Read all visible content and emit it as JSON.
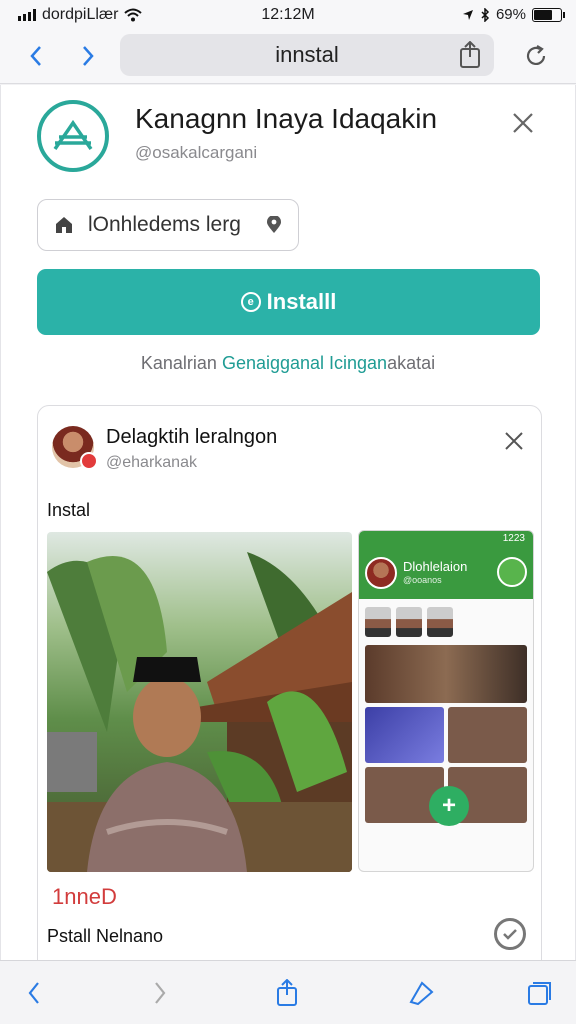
{
  "status_bar": {
    "carrier": "dordpiLlær",
    "time": "12:12M",
    "battery": "69%",
    "battery_level": 0.69
  },
  "browser": {
    "url_text": "innstal",
    "back_icon": "chevron-left-icon",
    "forward_icon": "chevron-right-icon",
    "share_icon": "share-icon",
    "reload_icon": "reload-icon"
  },
  "app": {
    "title": "Kanagnn Inaya Idaqakin",
    "handle": "@osakalcargani",
    "location_placeholder": "lOnhledems lerg",
    "install_label": "Installl",
    "caption_prefix": "Kanalrian",
    "caption_link": "Genaigganal Icingan",
    "caption_suffix": "akatai"
  },
  "card": {
    "name": "Delagktih leralngon",
    "handle": "@eharkanak",
    "label": "Instal",
    "red_text": "1nneD",
    "bottom_label": "Pstall Nelnano",
    "phone": {
      "time": "1223",
      "name": "Dlohlelaion",
      "handle": "@ooanos"
    }
  },
  "colors": {
    "accent": "#2bb2a8",
    "link": "#1f9c94",
    "red": "#d23c3c",
    "phone_green": "#3a9a3f"
  }
}
